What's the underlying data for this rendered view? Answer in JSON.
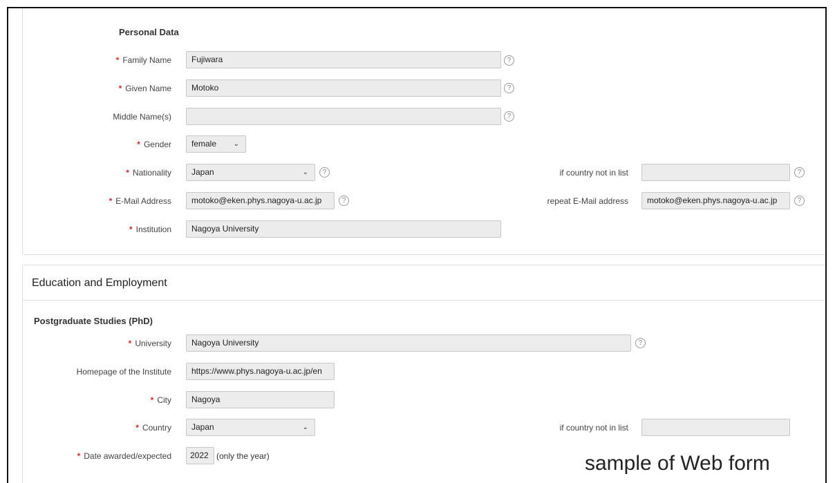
{
  "personal": {
    "title": "Personal Data",
    "family_name": {
      "label": "Family Name",
      "value": "Fujiwara"
    },
    "given_name": {
      "label": "Given Name",
      "value": "Motoko"
    },
    "middle_name": {
      "label": "Middle Name(s)",
      "value": ""
    },
    "gender": {
      "label": "Gender",
      "value": "female"
    },
    "nationality": {
      "label": "Nationality",
      "value": "Japan"
    },
    "nationality_other": {
      "label": "if country not in list",
      "value": ""
    },
    "email": {
      "label": "E-Mail Address",
      "value": "motoko@eken.phys.nagoya-u.ac.jp"
    },
    "email_repeat": {
      "label": "repeat E-Mail address",
      "value": "motoko@eken.phys.nagoya-u.ac.jp"
    },
    "institution": {
      "label": "Institution",
      "value": "Nagoya University"
    }
  },
  "education": {
    "title": "Education and Employment",
    "phd_title": "Postgraduate Studies (PhD)",
    "university": {
      "label": "University",
      "value": "Nagoya University"
    },
    "homepage": {
      "label": "Homepage of the Institute",
      "value": "https://www.phys.nagoya-u.ac.jp/en"
    },
    "city": {
      "label": "City",
      "value": "Nagoya"
    },
    "country": {
      "label": "Country",
      "value": "Japan"
    },
    "country_other": {
      "label": "if country not in list",
      "value": ""
    },
    "date_awarded": {
      "label": "Date awarded/expected",
      "value": "2022",
      "hint": "(only the year)"
    }
  },
  "icons": {
    "required": "*",
    "help": "?",
    "chevron": "chevron-down"
  },
  "caption": "sample of Web form",
  "colors": {
    "required": "#e32525",
    "field_bg": "#ececec",
    "border": "#dcdcdc"
  }
}
